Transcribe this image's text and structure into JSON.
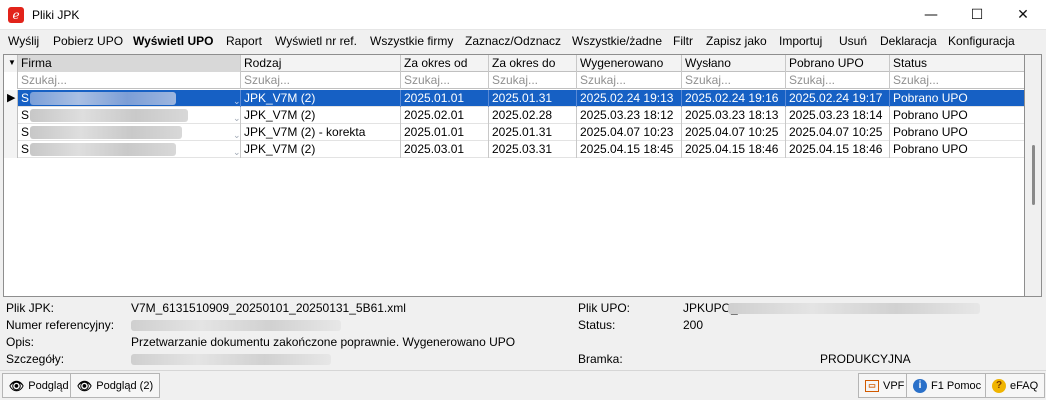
{
  "window": {
    "title": "Pliki JPK",
    "min_glyph": "—",
    "max_glyph": "☐",
    "close_glyph": "✕"
  },
  "menu": [
    {
      "label": "Wyślij",
      "bold": false
    },
    {
      "label": "Pobierz UPO",
      "bold": false
    },
    {
      "label": "Wyświetl UPO",
      "bold": true
    },
    {
      "label": "Raport",
      "bold": false
    },
    {
      "label": "Wyświetl nr ref.",
      "bold": false
    },
    {
      "label": "Wszystkie firmy",
      "bold": false
    },
    {
      "label": "Zaznacz/Odznacz",
      "bold": false
    },
    {
      "label": "Wszystkie/żadne",
      "bold": false
    },
    {
      "label": "Filtr",
      "bold": false
    },
    {
      "label": "Zapisz jako",
      "bold": false
    },
    {
      "label": "Importuj",
      "bold": false
    },
    {
      "label": "Usuń",
      "bold": false
    },
    {
      "label": "Deklaracja",
      "bold": false
    },
    {
      "label": "Konfiguracja",
      "bold": false
    }
  ],
  "grid": {
    "columns": [
      "Firma",
      "Rodzaj",
      "Za okres od",
      "Za okres do",
      "Wygenerowano",
      "Wysłano",
      "Pobrano UPO",
      "Status"
    ],
    "search_placeholder": "Szukaj...",
    "rows": [
      {
        "firma": "S",
        "rodzaj": "JPK_V7M (2)",
        "od": "2025.01.01",
        "do": "2025.01.31",
        "wygenerowano": "2025.02.24 19:13",
        "wyslano": "2025.02.24 19:16",
        "pobrano": "2025.02.24 19:17",
        "status": "Pobrano UPO",
        "selected": true
      },
      {
        "firma": "S",
        "rodzaj": "JPK_V7M (2)",
        "od": "2025.02.01",
        "do": "2025.02.28",
        "wygenerowano": "2025.03.23 18:12",
        "wyslano": "2025.03.23 18:13",
        "pobrano": "2025.03.23 18:14",
        "status": "Pobrano UPO",
        "selected": false
      },
      {
        "firma": "S",
        "rodzaj": "JPK_V7M (2) - korekta",
        "od": "2025.01.01",
        "do": "2025.01.31",
        "wygenerowano": "2025.04.07 10:23",
        "wyslano": "2025.04.07 10:25",
        "pobrano": "2025.04.07 10:25",
        "status": "Pobrano UPO",
        "selected": false
      },
      {
        "firma": "S",
        "rodzaj": "JPK_V7M (2)",
        "od": "2025.03.01",
        "do": "2025.03.31",
        "wygenerowano": "2025.04.15 18:45",
        "wyslano": "2025.04.15 18:46",
        "pobrano": "2025.04.15 18:46",
        "status": "Pobrano UPO",
        "selected": false
      }
    ]
  },
  "details": {
    "plik_jpk_label": "Plik JPK:",
    "plik_jpk_value": "V7M_6131510909_20250101_20250131_5B61.xml",
    "numer_label": "Numer referencyjny:",
    "opis_label": "Opis:",
    "opis_value": "Przetwarzanie dokumentu zakończone poprawnie. Wygenerowano UPO",
    "szczegoly_label": "Szczegóły:",
    "plik_upo_label": "Plik UPO:",
    "plik_upo_value": "JPKUPO_",
    "status_label": "Status:",
    "status_value": "200",
    "bramka_label": "Bramka:",
    "bramka_value": "PRODUKCYJNA"
  },
  "statusbar": {
    "podglad": "Podgląd",
    "podglad2": "Podgląd (2)",
    "vpf": "VPF",
    "pomoc": "F1 Pomoc",
    "efaq": "eFAQ"
  },
  "colors": {
    "selection": "#1660c4",
    "app_icon": "#e2231a"
  }
}
